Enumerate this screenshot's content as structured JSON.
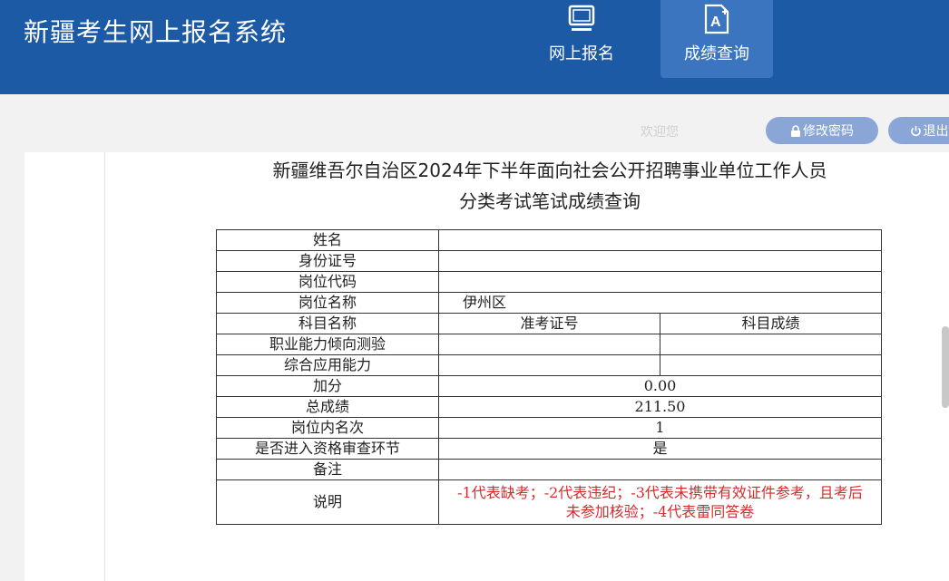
{
  "header": {
    "system_title": "新疆考生网上报名系统",
    "nav": [
      {
        "label": "网上报名",
        "icon": "monitor-icon",
        "active": false
      },
      {
        "label": "成绩查询",
        "icon": "score-document-icon",
        "active": true
      }
    ]
  },
  "userbar": {
    "welcome": "欢迎您",
    "username": "",
    "change_password": "修改密码",
    "logout": "退出"
  },
  "page": {
    "title_line1": "新疆维吾尔自治区2024年下半年面向社会公开招聘事业单位工作人员",
    "title_line2": "分类考试笔试成绩查询"
  },
  "score_table": {
    "rows": {
      "name": {
        "label": "姓名",
        "value": ""
      },
      "id_number": {
        "label": "身份证号",
        "value": ""
      },
      "post_code": {
        "label": "岗位代码",
        "value": ""
      },
      "post_name": {
        "label": "岗位名称",
        "value": "伊州区"
      },
      "subject_header": {
        "label": "科目名称",
        "ticket_col": "准考证号",
        "score_col": "科目成绩"
      },
      "subject_1": {
        "label": "职业能力倾向测验",
        "ticket": "",
        "score": ""
      },
      "subject_2": {
        "label": "综合应用能力",
        "ticket": "",
        "score": ""
      },
      "bonus": {
        "label": "加分",
        "value": "0.00"
      },
      "total": {
        "label": "总成绩",
        "value": "211.50"
      },
      "rank": {
        "label": "岗位内名次",
        "value": "1"
      },
      "qualified": {
        "label": "是否进入资格审查环节",
        "value": "是"
      },
      "remarks": {
        "label": "备注",
        "value": ""
      },
      "explanation": {
        "label": "说明",
        "value": "-1代表缺考；-2代表违纪；-3代表未携带有效证件参考，且考后未参加核验；-4代表雷同答卷"
      }
    }
  },
  "colors": {
    "header_bg": "#1d5aa6",
    "active_nav_bg": "#3b75c0",
    "button_bg": "#8aa6d6",
    "note_red": "#d42c2c"
  }
}
